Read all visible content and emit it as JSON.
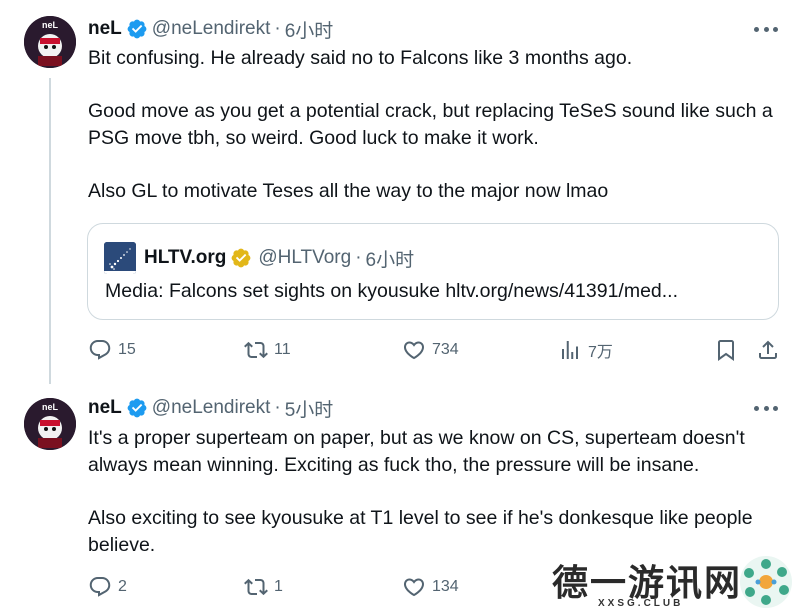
{
  "colors": {
    "text_primary": "#0f1419",
    "text_secondary": "#536471",
    "verified_blue": "#1d9bf0",
    "verified_gold": "#e2b719",
    "border": "#cfd9de"
  },
  "tweets": [
    {
      "author_name": "neL",
      "author_handle": "@neLendirekt",
      "dot": "·",
      "time": "6小时",
      "avatar_text": "neL",
      "body": [
        "Bit confusing. He already said no to Falcons like 3 months ago.",
        "Good move as you get a potential crack, but replacing TeSeS sound like such a PSG move tbh, so weird. Good luck to make it work.",
        "Also GL to motivate Teses all the way to the major now lmao"
      ],
      "quote": {
        "name": "HLTV.org",
        "handle": "@HLTVorg",
        "dot": "·",
        "time": "6小时",
        "text": "Media: Falcons set sights on kyousuke hltv.org/news/41391/med..."
      },
      "actions": {
        "reply_count": "15",
        "retweet_count": "11",
        "like_count": "734",
        "views_count": "7万"
      }
    },
    {
      "author_name": "neL",
      "author_handle": "@neLendirekt",
      "dot": "·",
      "time": "5小时",
      "avatar_text": "neL",
      "body": [
        "It's a proper superteam on paper, but as we know on CS, superteam doesn't always mean winning. Exciting as fuck tho, the pressure will be insane.",
        "Also exciting to see kyousuke at T1 level to see if he's donkesque like people believe."
      ],
      "actions": {
        "reply_count": "2",
        "retweet_count": "1",
        "like_count": "134"
      }
    }
  ],
  "watermark": {
    "title": "德一游讯网",
    "subtitle": "XXSG.CLUB"
  }
}
